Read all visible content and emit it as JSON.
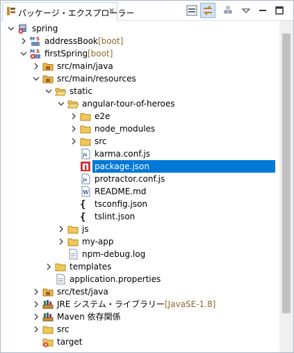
{
  "view": {
    "title": "パッケージ・エクスプローラー",
    "close_glyph": "✕"
  },
  "toolbar": [
    "collapse-all-icon",
    "link-with-editor-icon",
    "focus-icon",
    "view-menu-icon",
    "minimize-icon",
    "maximize-icon"
  ],
  "tree": [
    {
      "label": "spring",
      "decor": "",
      "depth": 0,
      "twisty": "open",
      "icon": "project-error"
    },
    {
      "label": "addressBook",
      "decor": " [boot]",
      "depth": 1,
      "twisty": "closed",
      "icon": "maven-project"
    },
    {
      "label": "firstSpring",
      "decor": " [boot]",
      "depth": 1,
      "twisty": "open",
      "icon": "maven-project-error"
    },
    {
      "label": "src/main/java",
      "decor": "",
      "depth": 2,
      "twisty": "closed",
      "icon": "source-folder"
    },
    {
      "label": "src/main/resources",
      "decor": "",
      "depth": 2,
      "twisty": "open",
      "icon": "source-folder"
    },
    {
      "label": "static",
      "decor": "",
      "depth": 3,
      "twisty": "open",
      "icon": "folder-open"
    },
    {
      "label": "angular-tour-of-heroes",
      "decor": "",
      "depth": 4,
      "twisty": "open",
      "icon": "folder-open"
    },
    {
      "label": "e2e",
      "decor": "",
      "depth": 5,
      "twisty": "closed",
      "icon": "folder"
    },
    {
      "label": "node_modules",
      "decor": "",
      "depth": 5,
      "twisty": "closed",
      "icon": "folder"
    },
    {
      "label": "src",
      "decor": "",
      "depth": 5,
      "twisty": "closed",
      "icon": "folder"
    },
    {
      "label": "karma.conf.js",
      "decor": "",
      "depth": 5,
      "twisty": "none",
      "icon": "js-file"
    },
    {
      "label": "package.json",
      "decor": "",
      "depth": 5,
      "twisty": "none",
      "icon": "npm-file",
      "selected": true
    },
    {
      "label": "protractor.conf.js",
      "decor": "",
      "depth": 5,
      "twisty": "none",
      "icon": "js-file"
    },
    {
      "label": "README.md",
      "decor": "",
      "depth": 5,
      "twisty": "none",
      "icon": "word-file"
    },
    {
      "label": "tsconfig.json",
      "decor": "",
      "depth": 5,
      "twisty": "none",
      "icon": "json-file"
    },
    {
      "label": "tslint.json",
      "decor": "",
      "depth": 5,
      "twisty": "none",
      "icon": "json-file"
    },
    {
      "label": "js",
      "decor": "",
      "depth": 4,
      "twisty": "closed",
      "icon": "folder"
    },
    {
      "label": "my-app",
      "decor": "",
      "depth": 4,
      "twisty": "closed",
      "icon": "folder"
    },
    {
      "label": "npm-debug.log",
      "decor": "",
      "depth": 4,
      "twisty": "none",
      "icon": "text-file"
    },
    {
      "label": "templates",
      "decor": "",
      "depth": 3,
      "twisty": "closed",
      "icon": "folder"
    },
    {
      "label": "application.properties",
      "decor": "",
      "depth": 3,
      "twisty": "none",
      "icon": "properties-file"
    },
    {
      "label": "src/test/java",
      "decor": "",
      "depth": 2,
      "twisty": "closed",
      "icon": "source-folder"
    },
    {
      "label": "JRE システム・ライブラリー",
      "decor": " [JavaSE-1.8]",
      "depth": 2,
      "twisty": "closed",
      "icon": "library"
    },
    {
      "label": "Maven 依存関係",
      "decor": "",
      "depth": 2,
      "twisty": "closed",
      "icon": "library"
    },
    {
      "label": "src",
      "decor": "",
      "depth": 2,
      "twisty": "closed",
      "icon": "folder"
    },
    {
      "label": "target",
      "decor": "",
      "depth": 2,
      "twisty": "none",
      "icon": "folder-error"
    }
  ],
  "colors": {
    "selection": "#0078d7",
    "decoration": "#8b6b2a",
    "folder": "#e8b84a"
  }
}
